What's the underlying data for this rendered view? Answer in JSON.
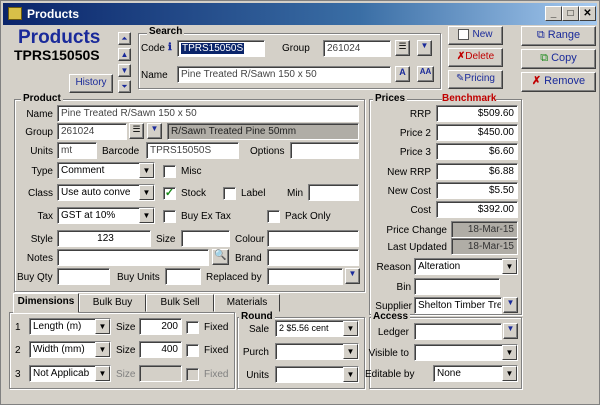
{
  "window": {
    "title": "Products"
  },
  "header": {
    "title": "Products",
    "code": "TPRS15050S",
    "history_label": "History"
  },
  "search": {
    "group_label": "Search",
    "code_label": "Code",
    "code_value": "TPRS15050S",
    "group_label_text": "Group",
    "group_value": "261024",
    "name_label": "Name",
    "name_value": "Pine Treated R/Sawn 150 x 50"
  },
  "actions": {
    "new": "New",
    "delete": "Delete",
    "pricing": "Pricing",
    "range": "Range",
    "copy": "Copy",
    "remove": "Remove"
  },
  "product": {
    "group_label": "Product",
    "name_label": "Name",
    "name_value": "Pine Treated R/Sawn 150 x 50",
    "group_label_text": "Group",
    "group_value": "261024",
    "group_desc": "R/Sawn Treated Pine 50mm",
    "units_label": "Units",
    "units_value": "mt",
    "barcode_label": "Barcode",
    "barcode_value": "TPRS15050S",
    "options_label": "Options",
    "options_value": "",
    "type_label": "Type",
    "type_value": "Comment",
    "misc_label": "Misc",
    "class_label": "Class",
    "class_value": "Use auto conve",
    "stock_label": "Stock",
    "label_label": "Label",
    "min_label": "Min",
    "min_value": "",
    "tax_label": "Tax",
    "tax_value": "GST at 10%",
    "buyex_label": "Buy Ex Tax",
    "packonly_label": "Pack Only",
    "style_label": "Style",
    "style_value": "123",
    "size_label": "Size",
    "size_value": "",
    "colour_label": "Colour",
    "colour_value": "",
    "notes_label": "Notes",
    "notes_value": "",
    "brand_label": "Brand",
    "brand_value": "",
    "buyqty_label": "Buy Qty",
    "buyqty_value": "",
    "buyunits_label": "Buy Units",
    "buyunits_value": "",
    "replacedby_label": "Replaced by",
    "replacedby_value": ""
  },
  "tabs": [
    "Dimensions",
    "Bulk Buy",
    "Bulk Sell",
    "Materials"
  ],
  "dimensions": {
    "rows": [
      {
        "num": "1",
        "type": "Length (m)",
        "size_label": "Size",
        "size": "200",
        "fixed_label": "Fixed"
      },
      {
        "num": "2",
        "type": "Width (mm)",
        "size_label": "Size",
        "size": "400",
        "fixed_label": "Fixed"
      },
      {
        "num": "3",
        "type": "Not Applicab",
        "size_label": "Size",
        "size": "",
        "fixed_label": "Fixed"
      }
    ]
  },
  "round": {
    "group_label": "Round",
    "sale_label": "Sale",
    "sale_value": "2  $5.56 cent",
    "purch_label": "Purch",
    "purch_value": "",
    "units_label": "Units",
    "units_value": ""
  },
  "prices": {
    "group_label": "Prices",
    "benchmark_label": "Benchmark",
    "rrp_label": "RRP",
    "rrp": "$509.60",
    "price2_label": "Price 2",
    "price2": "$450.00",
    "price3_label": "Price 3",
    "price3": "$6.60",
    "newrrp_label": "New RRP",
    "newrrp": "$6.88",
    "newcost_label": "New Cost",
    "newcost": "$5.50",
    "cost_label": "Cost",
    "cost": "$392.00",
    "pricechange_label": "Price Change",
    "pricechange": "18-Mar-15",
    "lastupdated_label": "Last Updated",
    "lastupdated": "18-Mar-15",
    "reason_label": "Reason",
    "reason": "Alteration",
    "bin_label": "Bin",
    "bin": "",
    "supplier_label": "Supplier",
    "supplier": "Shelton Timber Tre"
  },
  "access": {
    "group_label": "Access",
    "ledger_label": "Ledger",
    "ledger": "",
    "visible_label": "Visible to",
    "visible": "",
    "editable_label": "Editable by",
    "editable": "None"
  }
}
